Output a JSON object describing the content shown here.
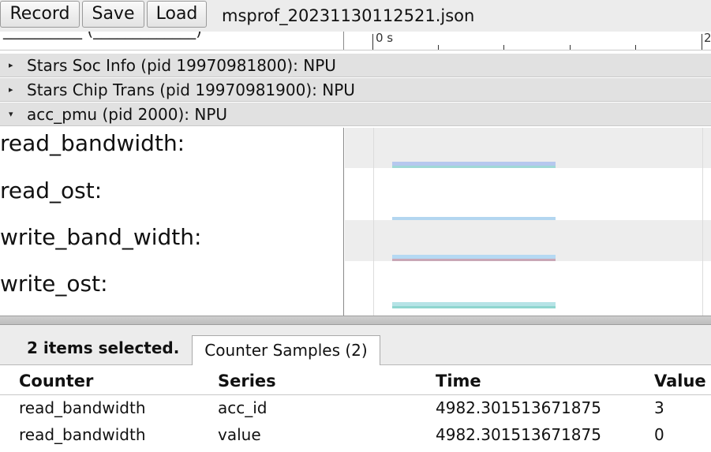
{
  "toolbar": {
    "record_label": "Record",
    "save_label": "Save",
    "load_label": "Load",
    "file_name": "msprof_20231130112521.json"
  },
  "ruler": {
    "clipped_text": "__________ (_____________)",
    "start_label": "0 s",
    "end_label": "2"
  },
  "processes": [
    {
      "arrow": "▸",
      "title": "Stars Soc Info (pid 19970981800): NPU"
    },
    {
      "arrow": "▸",
      "title": "Stars Chip Trans (pid 19970981900): NPU"
    },
    {
      "arrow": "▾",
      "title": "acc_pmu (pid 2000): NPU"
    }
  ],
  "tracks": [
    {
      "label": "read_bandwidth:",
      "colors": [
        "#b6c8ee",
        "#9fd8d6"
      ]
    },
    {
      "label": "read_ost:",
      "colors": [
        "#b3d6f0",
        "#d6a8c8"
      ]
    },
    {
      "label": "write_band_width:",
      "colors": [
        "#b5d9f3",
        "#c9a7b6"
      ]
    },
    {
      "label": "write_ost:",
      "colors": [
        "#b6e3e6",
        "#8fd6cf"
      ]
    }
  ],
  "selection": {
    "summary": "2 items selected.",
    "tab_label": "Counter Samples (2)"
  },
  "table": {
    "headers": [
      "Counter",
      "Series",
      "Time",
      "Value"
    ],
    "rows": [
      [
        "read_bandwidth",
        "acc_id",
        "4982.301513671875",
        "3"
      ],
      [
        "read_bandwidth",
        "value",
        "4982.301513671875",
        "0"
      ]
    ]
  }
}
